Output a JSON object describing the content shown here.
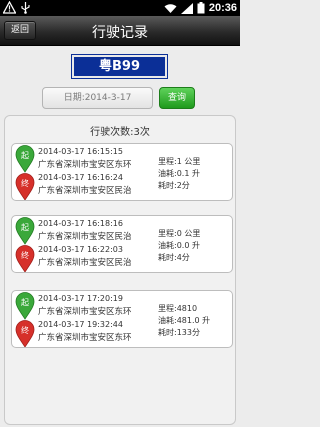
{
  "status_bar": {
    "time": "20:36"
  },
  "header": {
    "back_label": "返回",
    "title": "行驶记录"
  },
  "vehicle": {
    "plate": "粤B99"
  },
  "query": {
    "date_text": "日期:2014-3-17",
    "button_label": "查询"
  },
  "summary": {
    "count_text": "行驶次数:3次"
  },
  "markers": {
    "start": "起",
    "end": "终"
  },
  "trips": [
    {
      "start_time": "2014-03-17 16:15:15",
      "start_address": "广东省深圳市宝安区东环",
      "end_time": "2014-03-17 16:16:24",
      "end_address": "广东省深圳市宝安区民治",
      "mileage": "里程:1 公里",
      "fuel": "油耗:0.1 升",
      "duration": "耗时:2分"
    },
    {
      "start_time": "2014-03-17 16:18:16",
      "start_address": "广东省深圳市宝安区民治",
      "end_time": "2014-03-17 16:22:03",
      "end_address": "广东省深圳市宝安区民治",
      "mileage": "里程:0 公里",
      "fuel": "油耗:0.0 升",
      "duration": "耗时:4分"
    },
    {
      "start_time": "2014-03-17 17:20:19",
      "start_address": "广东省深圳市宝安区东环",
      "end_time": "2014-03-17 19:32:44",
      "end_address": "广东省深圳市宝安区东环",
      "mileage": "里程:4810",
      "fuel": "油耗:481.0 升",
      "duration": "耗时:133分"
    }
  ],
  "colors": {
    "plate_bg": "#0b2f97",
    "query_green": "#2aa626",
    "start_pin": "#3aa83a",
    "end_pin": "#d6302a"
  }
}
